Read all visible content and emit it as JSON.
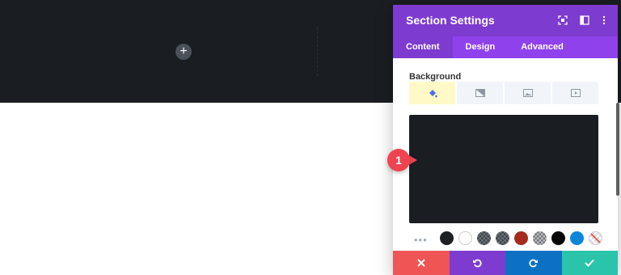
{
  "modal": {
    "title": "Section Settings",
    "tabs": [
      "Content",
      "Design",
      "Advanced"
    ],
    "active_tab": "Content",
    "header_colors": {
      "primary": "#7e3bd0",
      "tabs": "#8f42ec"
    }
  },
  "background": {
    "label": "Background",
    "tabs": [
      {
        "icon": "paint-bucket-icon",
        "active": true
      },
      {
        "icon": "gradient-icon",
        "active": false
      },
      {
        "icon": "image-icon",
        "active": false
      },
      {
        "icon": "video-icon",
        "active": false
      }
    ],
    "preview_color": "#1a1d21"
  },
  "swatches": {
    "more_label": "•••",
    "colors": [
      "#1d1f22",
      "#ffffff",
      "#3d4248",
      "#3d4248",
      "#a52a1c",
      "#bfbfbf",
      "#050505",
      "#0c86d9",
      "transparent"
    ]
  },
  "footer": {
    "colors": {
      "discard": "#ef5555",
      "undo": "#7e3bd0",
      "redo": "#0c71c3",
      "save": "#29c4a9"
    }
  },
  "callout": {
    "number": "1"
  },
  "canvas": {
    "add_icon": "+"
  }
}
